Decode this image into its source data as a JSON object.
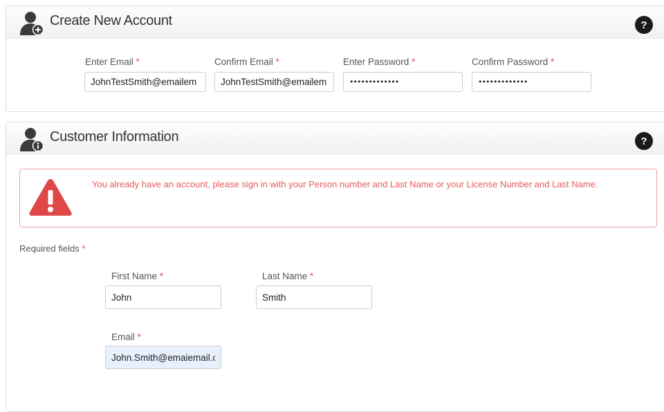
{
  "create_account": {
    "title": "Create New Account",
    "icon": "user-add-icon",
    "help_icon": "help-circle-icon",
    "fields": [
      {
        "label": "Enter Email",
        "required_mark": "*",
        "value": "JohnTestSmith@emailem"
      },
      {
        "label": "Confirm Email",
        "required_mark": "*",
        "value": "JohnTestSmith@emailem"
      },
      {
        "label": "Enter Password",
        "required_mark": "*",
        "value": "•••••••••••••"
      },
      {
        "label": "Confirm Password",
        "required_mark": "*",
        "value": "•••••••••••••"
      }
    ]
  },
  "customer_info": {
    "title": "Customer Information",
    "icon": "user-info-icon",
    "help_icon": "help-circle-icon",
    "alert": {
      "icon": "warning-triangle-icon",
      "message": "You already have an account, please sign in with your Person number and Last Name or your License Number and Last Name."
    },
    "required_note": {
      "label": "Required fields",
      "mark": "*"
    },
    "fields": {
      "first_name": {
        "label": "First Name",
        "required_mark": "*",
        "value": "John"
      },
      "last_name": {
        "label": "Last Name",
        "required_mark": "*",
        "value": "Smith"
      },
      "email": {
        "label": "Email",
        "required_mark": "*",
        "value": "John.Smith@emaiemail.c"
      }
    }
  },
  "colors": {
    "required": "#d9534f",
    "alert_border": "#f0a0a0",
    "alert_text": "#e65a5a",
    "alert_icon": "#e04848",
    "autofill_bg": "#e8f0fe"
  }
}
